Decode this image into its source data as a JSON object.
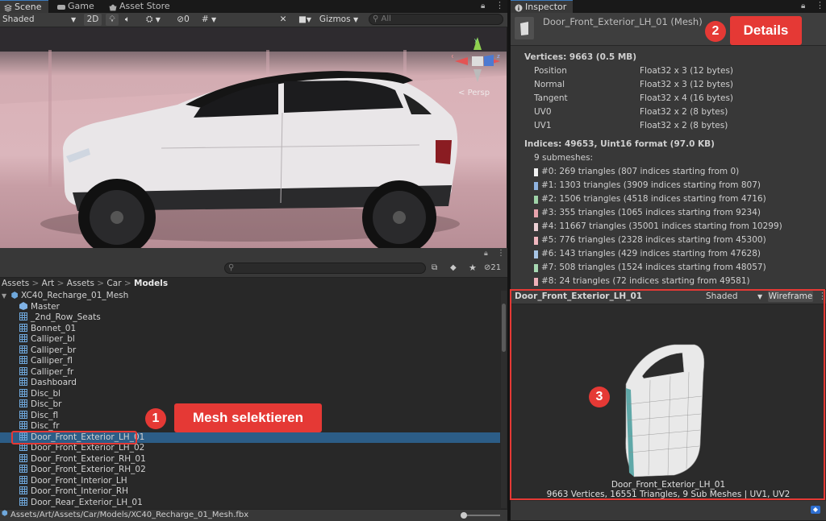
{
  "tabs_left": [
    {
      "label": "Scene"
    },
    {
      "label": "Game"
    },
    {
      "label": "Asset Store"
    }
  ],
  "inspector_tab": {
    "label": "Inspector"
  },
  "scene_toolbar": {
    "shading_mode": "Shaded",
    "mode_2d": "2D",
    "hidden_count": "0",
    "gizmos_label": "Gizmos",
    "search_placeholder": "All"
  },
  "scene_view": {
    "persp_label": "Persp",
    "gizmo_axes": [
      "y",
      "x",
      "z"
    ]
  },
  "project_panel": {
    "badge_count": "21",
    "breadcrumb": [
      "Assets",
      "Art",
      "Assets",
      "Car",
      "Models"
    ],
    "root": "XC40_Recharge_01_Mesh",
    "items": [
      "Master",
      "_2nd_Row_Seats",
      "Bonnet_01",
      "Calliper_bl",
      "Calliper_br",
      "Calliper_fl",
      "Calliper_fr",
      "Dashboard",
      "Disc_bl",
      "Disc_br",
      "Disc_fl",
      "Disc_fr",
      "Door_Front_Exterior_LH_01",
      "Door_Front_Exterior_LH_02",
      "Door_Front_Exterior_RH_01",
      "Door_Front_Exterior_RH_02",
      "Door_Front_Interior_LH",
      "Door_Front_Interior_RH",
      "Door_Rear_Exterior_LH_01"
    ],
    "selected_index": 12,
    "status_path": "Assets/Art/Assets/Car/Models/XC40_Recharge_01_Mesh.fbx"
  },
  "inspector": {
    "title": "Door_Front_Exterior_LH_01 (Mesh)",
    "vertices_header": "Vertices: 9663 (0.5 MB)",
    "attributes": [
      {
        "name": "Position",
        "format": "Float32 x 3 (12 bytes)"
      },
      {
        "name": "Normal",
        "format": "Float32 x 3 (12 bytes)"
      },
      {
        "name": "Tangent",
        "format": "Float32 x 4 (16 bytes)"
      },
      {
        "name": "UV0",
        "format": "Float32 x 2 (8 bytes)"
      },
      {
        "name": "UV1",
        "format": "Float32 x 2 (8 bytes)"
      }
    ],
    "indices_header": "Indices: 49653, Uint16 format (97.0 KB)",
    "submesh_count": "9 submeshes:",
    "submeshes": [
      {
        "text": "#0: 269 triangles (807 indices starting from 0)",
        "color": "#f2f2f2"
      },
      {
        "text": "#1: 1303 triangles (3909 indices starting from 807)",
        "color": "#8fb3df"
      },
      {
        "text": "#2: 1506 triangles (4518 indices starting from 4716)",
        "color": "#9fd3a8"
      },
      {
        "text": "#3: 355 triangles (1065 indices starting from 9234)",
        "color": "#e8a3ad"
      },
      {
        "text": "#4: 11667 triangles (35001 indices starting from 10299)",
        "color": "#ecd0d5"
      },
      {
        "text": "#5: 776 triangles (2328 indices starting from 45300)",
        "color": "#f1b7bf"
      },
      {
        "text": "#6: 143 triangles (429 indices starting from 47628)",
        "color": "#a8c6e6"
      },
      {
        "text": "#7: 508 triangles (1524 indices starting from 48057)",
        "color": "#a7d8b2"
      },
      {
        "text": "#8: 24 triangles (72 indices starting from 49581)",
        "color": "#eeb0b9"
      }
    ],
    "preview": {
      "name": "Door_Front_Exterior_LH_01",
      "mode": "Shaded",
      "wireframe_label": "Wireframe",
      "caption_name": "Door_Front_Exterior_LH_01",
      "caption_stats": "9663 Vertices, 16551 Triangles, 9 Sub Meshes | UV1, UV2"
    }
  },
  "annotations": [
    {
      "number": "1",
      "label": "Mesh selektieren"
    },
    {
      "number": "2",
      "label": "Details"
    },
    {
      "number": "3",
      "label": ""
    }
  ],
  "colors": {
    "accent_red": "#e53935",
    "selection": "#2c5d87",
    "tab_accent": "#3a79bb"
  }
}
